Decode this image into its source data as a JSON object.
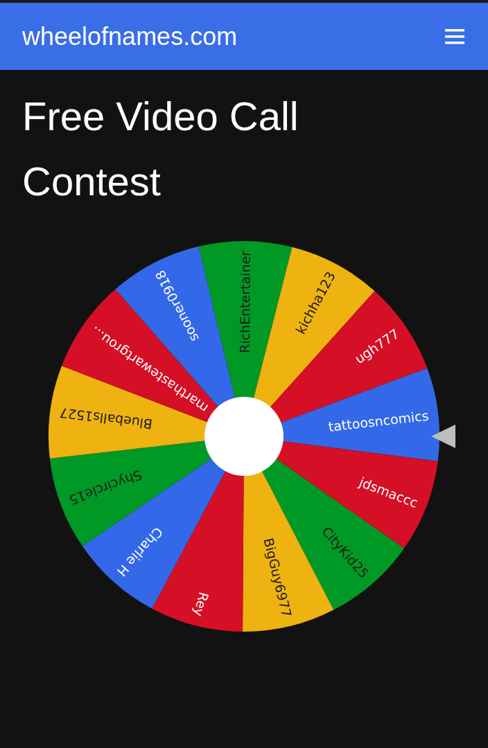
{
  "header": {
    "site_name": "wheelofnames.com"
  },
  "title": "Free Video Call Contest",
  "wheel": {
    "entries": [
      {
        "name": "RichEntertainer",
        "color": "#009925"
      },
      {
        "name": "kichha123",
        "color": "#eeb211"
      },
      {
        "name": "ugh777",
        "color": "#d50f25"
      },
      {
        "name": "tattoosncomics",
        "color": "#3369e8"
      },
      {
        "name": "jdsmaccc",
        "color": "#d50f25"
      },
      {
        "name": "CityKid25",
        "color": "#009925"
      },
      {
        "name": "BigGuy6977",
        "color": "#eeb211"
      },
      {
        "name": "Rey",
        "color": "#d50f25"
      },
      {
        "name": "Charlie H",
        "color": "#3369e8"
      },
      {
        "name": "Shycircle15",
        "color": "#009925"
      },
      {
        "name": "Blueballs1527",
        "color": "#eeb211"
      },
      {
        "name": "marthastewartgrou...",
        "color": "#d50f25"
      },
      {
        "name": "sooner0918",
        "color": "#3369e8"
      }
    ]
  }
}
